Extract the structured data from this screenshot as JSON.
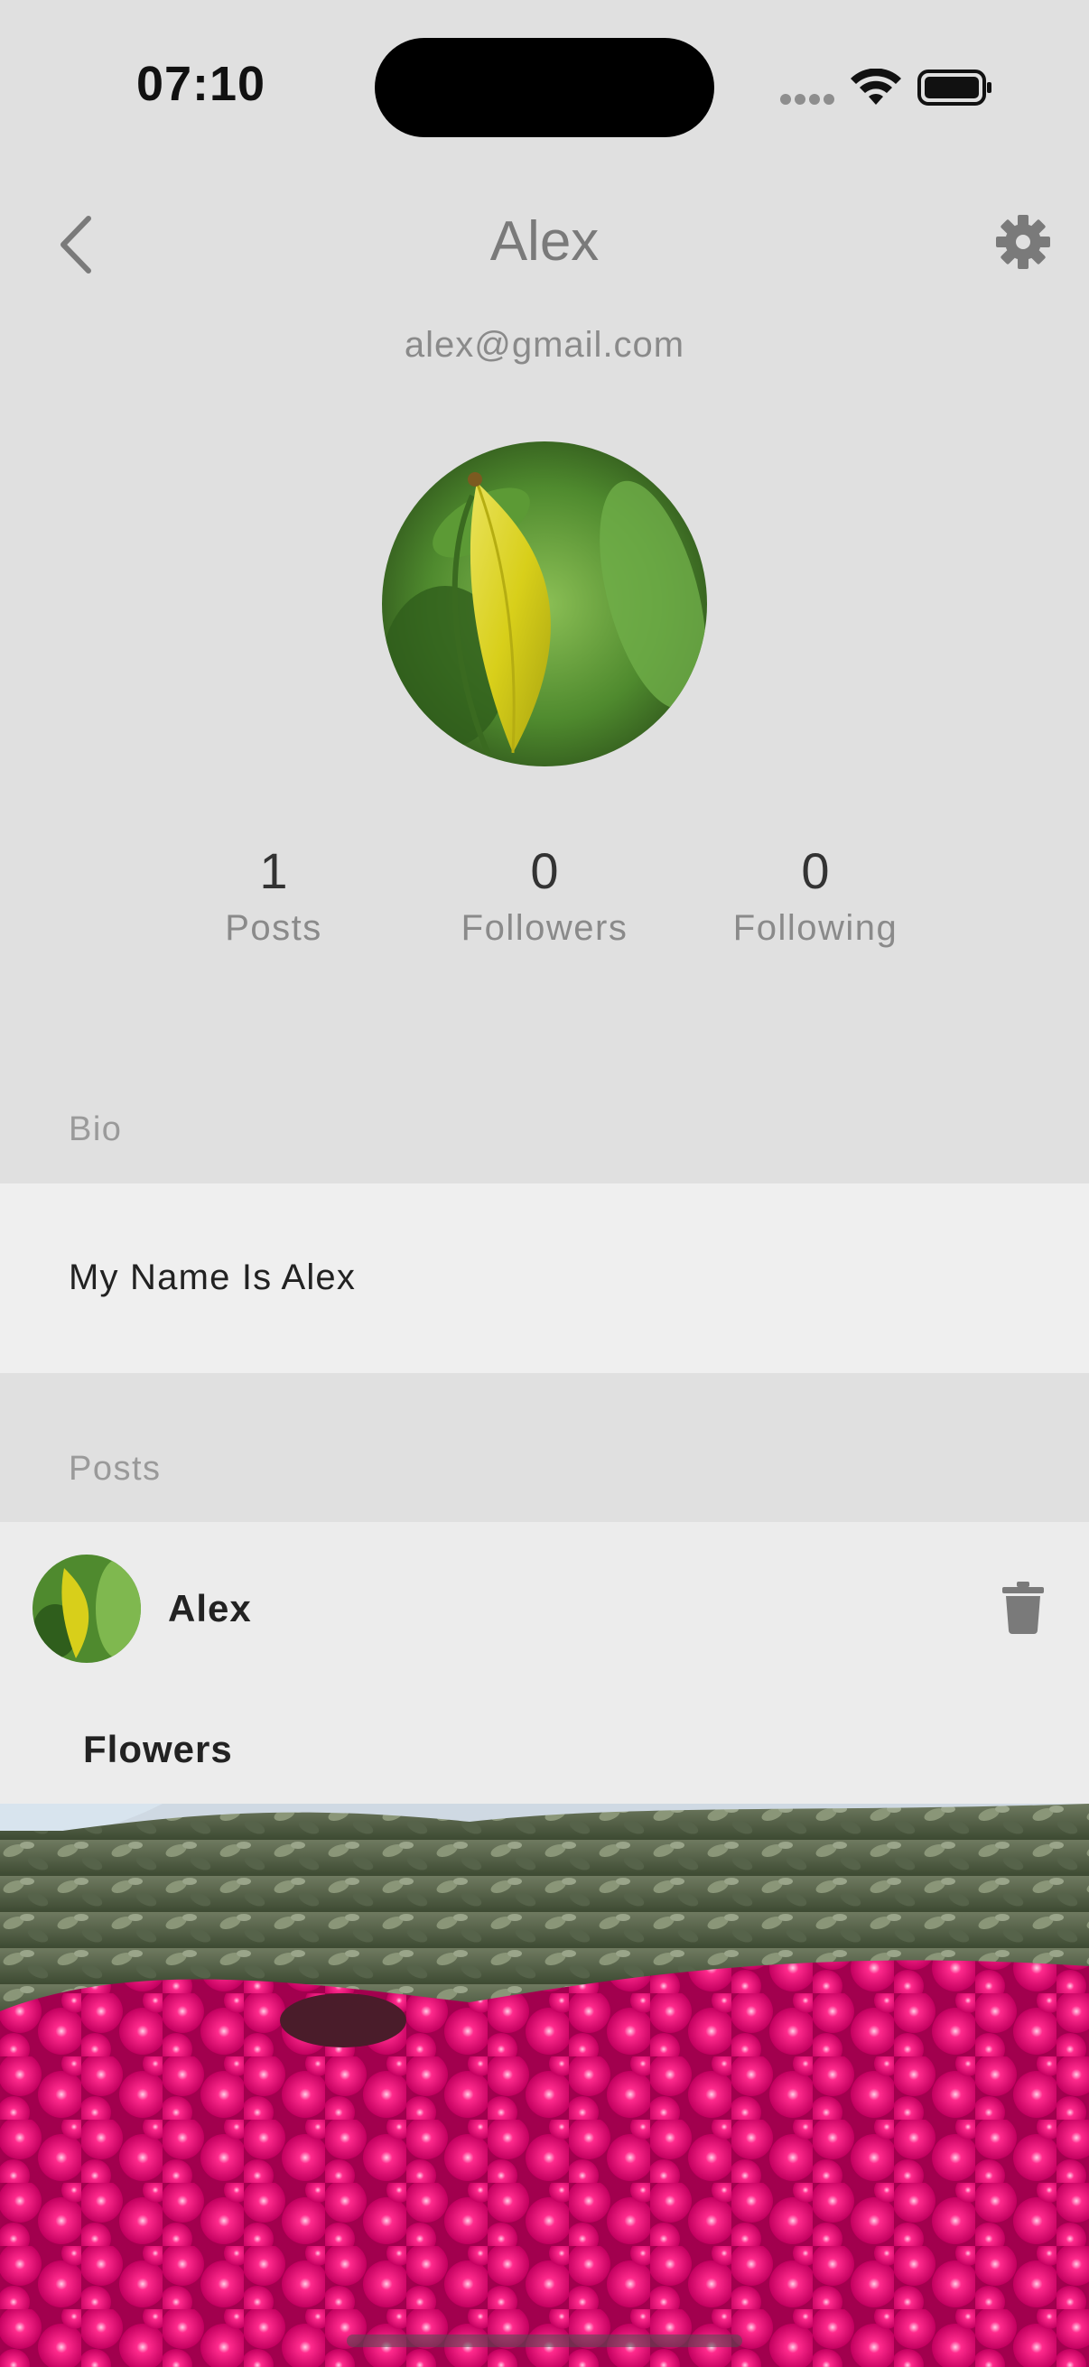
{
  "status_bar": {
    "time": "07:10"
  },
  "header": {
    "title": "Alex",
    "email": "alex@gmail.com"
  },
  "stats": [
    {
      "value": "1",
      "label": "Posts"
    },
    {
      "value": "0",
      "label": "Followers"
    },
    {
      "value": "0",
      "label": "Following"
    }
  ],
  "bio": {
    "section_label": "Bio",
    "text": "My Name Is Alex"
  },
  "posts": {
    "section_label": "Posts",
    "items": [
      {
        "author": "Alex",
        "caption": "Flowers"
      }
    ]
  },
  "icons": {
    "back": "chevron-left-icon",
    "settings": "gear-icon",
    "delete": "trash-icon",
    "wifi": "wifi-icon",
    "battery": "battery-icon"
  },
  "colors": {
    "background": "#e0e0e0",
    "card": "#efefef",
    "muted_text": "#8a8a8a"
  }
}
